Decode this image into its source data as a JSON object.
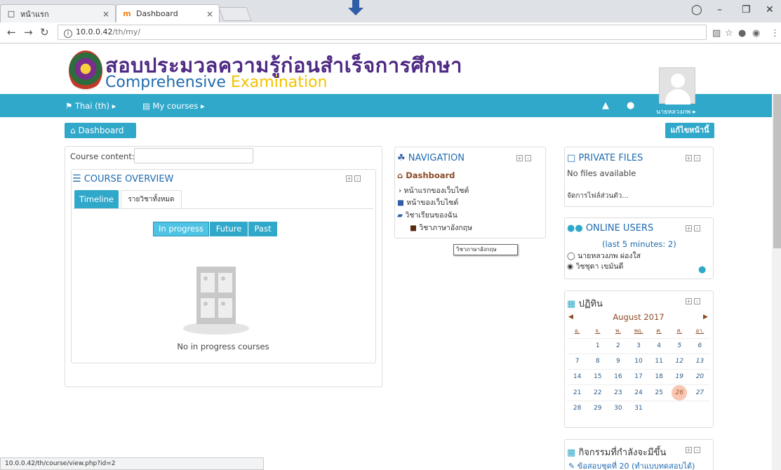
{
  "browser": {
    "tabs": [
      {
        "title": "หน้าแรก",
        "icon": "page-icon"
      },
      {
        "title": "Dashboard",
        "icon": "moodle-icon"
      }
    ],
    "url_host": "10.0.0.42",
    "url_path": "/th/my/",
    "status_url": "10.0.0.42/th/course/view.php?id=2"
  },
  "header": {
    "title_th": "สอบประมวลความรู้ก่อนสำเร็จการศึกษา",
    "subtitle_a": "Comprehensive",
    "subtitle_b": "Examination"
  },
  "navbar": {
    "language": "Thai (th)",
    "my_courses": "My courses",
    "user_name": "นายหลวงภพ"
  },
  "actions": {
    "dashboard": "Dashboard",
    "edit_page": "แก้ไขหน้านี้"
  },
  "main": {
    "course_content_label": "Course content:",
    "overview_title": "COURSE OVERVIEW",
    "tabs": [
      "Timeline",
      "รายวิชาทั้งหมด"
    ],
    "filters": [
      "In progress",
      "Future",
      "Past"
    ],
    "empty_message": "No in progress courses"
  },
  "navigation": {
    "title": "NAVIGATION",
    "items": [
      "Dashboard",
      "หน้าแรกของเว็บไซต์",
      "หน้าของเว็บไซต์",
      "วิชาเรียนของฉัน",
      "วิชาภาษาอังกฤษ"
    ],
    "tooltip": "วิชาภาษาอังกฤษ"
  },
  "private_files": {
    "title": "PRIVATE FILES",
    "empty": "No files available",
    "manage_link": "จัดการไฟล์ส่วนตัว..."
  },
  "online_users": {
    "title": "ONLINE USERS",
    "subtitle": "(last 5 minutes: 2)",
    "users": [
      "นายหลวงภพ ผ่องใส",
      "วิชชุดา เขมันดี"
    ]
  },
  "calendar": {
    "title": "ปฏิทิน",
    "month": "August 2017",
    "days": [
      "อ.",
      "จ.",
      "พ.",
      "พฤ.",
      "ศ.",
      "ส.",
      "อา."
    ],
    "weeks": [
      [
        "",
        "1",
        "2",
        "3",
        "4",
        "5",
        "6"
      ],
      [
        "7",
        "8",
        "9",
        "10",
        "11",
        "12",
        "13"
      ],
      [
        "14",
        "15",
        "16",
        "17",
        "18",
        "19",
        "20"
      ],
      [
        "21",
        "22",
        "23",
        "24",
        "25",
        "26",
        "27"
      ],
      [
        "28",
        "29",
        "30",
        "31",
        "",
        "",
        ""
      ]
    ],
    "today": "26"
  },
  "upcoming": {
    "title": "กิจกรรมที่กำลังจะมีขึ้น",
    "item": "ข้อสอบชุดที่ 20 (ทำแบบทดสอบได้)"
  },
  "colors": {
    "accent": "#30a8ca",
    "brand_purple": "#4e2a84",
    "link_blue": "#1f6bb0",
    "nav_brown": "#8a4a26"
  }
}
